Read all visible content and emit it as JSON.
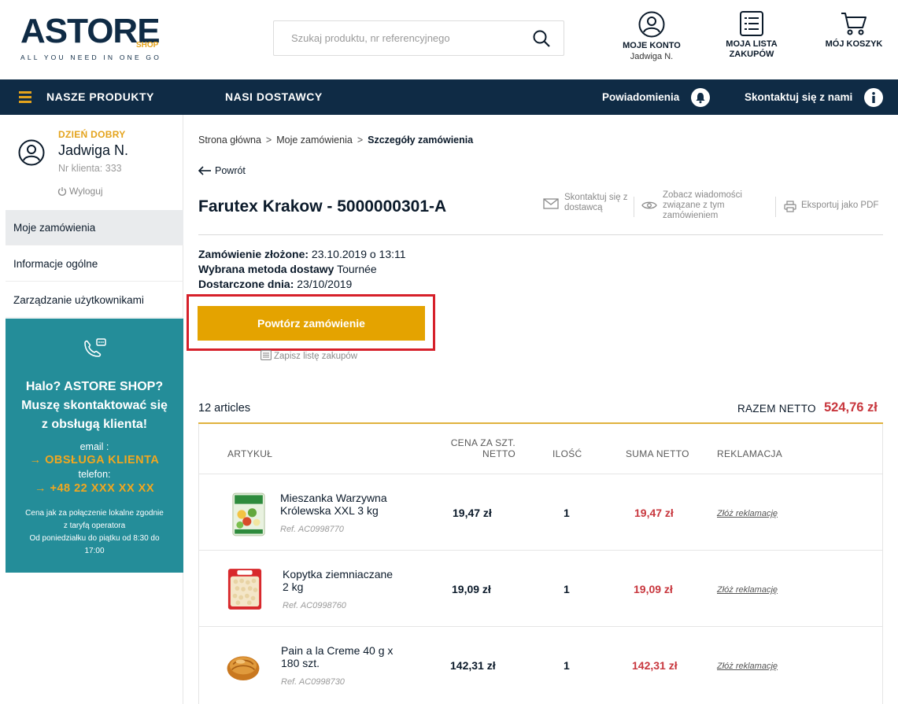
{
  "brand": {
    "name": "ASTORE",
    "sub": "SHOP",
    "tagline": "ALL YOU NEED IN ONE GO"
  },
  "search": {
    "placeholder": "Szukaj produktu, nr referencyjnego",
    "value": ""
  },
  "header": {
    "account_label": "MOJE KONTO",
    "account_user": "Jadwiga N.",
    "list_label_1": "MOJA LISTA",
    "list_label_2": "ZAKUPÓW",
    "cart_label": "MÓJ KOSZYK"
  },
  "nav": {
    "products": "NASZE PRODUKTY",
    "suppliers": "NASI DOSTAWCY",
    "notifications": "Powiadomienia",
    "contact": "Skontaktuj się z nami"
  },
  "sidebar": {
    "greeting": "DZIEŃ DOBRY",
    "user_name": "Jadwiga N.",
    "client_no": "Nr klienta: 333",
    "logout": "Wyloguj",
    "items": [
      {
        "label": "Moje zamówienia",
        "active": true
      },
      {
        "label": "Informacje ogólne",
        "active": false
      },
      {
        "label": "Zarządzanie użytkownikami",
        "active": false
      }
    ],
    "help": {
      "title_1": "Halo? ASTORE SHOP?",
      "title_2": "Muszę skontaktować się",
      "title_3": "z obsługą klienta!",
      "email_label": "email :",
      "email_value": "→ OBSŁUGA KLIENTA",
      "phone_label": "telefon:",
      "phone_value": "→ +48 22 XXX XX XX",
      "note_1": "Cena jak za połączenie lokalne zgodnie",
      "note_2": "z taryfą operatora",
      "note_3": "Od poniedziałku do piątku od 8:30 do",
      "note_4": "17:00"
    }
  },
  "breadcrumb": {
    "home": "Strona główna",
    "orders": "Moje zamówienia",
    "current": "Szczegóły zamówienia",
    "sep": ">"
  },
  "back_label": "Powrót",
  "order": {
    "title": "Farutex Krakow - 5000000301-A",
    "actions": {
      "contact_1": "Skontaktuj się z",
      "contact_2": "dostawcą",
      "messages_1": "Zobacz wiadomości",
      "messages_2": "związane z tym",
      "messages_3": "zamówieniem",
      "export": "Eksportuj jako PDF"
    },
    "placed_label": "Zamówienie złożone:",
    "placed_value": "23.10.2019 o 13:11",
    "method_label": "Wybrana metoda dostawy",
    "method_value": "Tournée",
    "delivered_label": "Dostarczone dnia:",
    "delivered_value": "23/10/2019",
    "repeat_button": "Powtórz zamówienie",
    "save_list": "Zapisz listę zakupów",
    "articles_count": "12 articles",
    "total_label": "RAZEM NETTO",
    "total_value": "524,76 zł"
  },
  "table": {
    "headers": {
      "article": "ARTYKUŁ",
      "unit_price_1": "CENA ZA SZT.",
      "unit_price_2": "NETTO",
      "qty": "ILOŚĆ",
      "sum": "SUMA NETTO",
      "claim": "REKLAMACJA"
    },
    "rows": [
      {
        "name_1": "Mieszanka Warzywna",
        "name_2": "Królewska XXL 3 kg",
        "ref": "Ref. AC0998770",
        "price": "19,47 zł",
        "qty": "1",
        "sum": "19,47 zł",
        "claim": "Złóż reklamację"
      },
      {
        "name_1": "Kopytka ziemniaczane",
        "name_2": "2 kg",
        "ref": "Ref. AC0998760",
        "price": "19,09 zł",
        "qty": "1",
        "sum": "19,09 zł",
        "claim": "Złóż reklamację"
      },
      {
        "name_1": "Pain a la Creme 40 g x",
        "name_2": "180 szt.",
        "ref": "Ref. AC0998730",
        "price": "142,31 zł",
        "qty": "1",
        "sum": "142,31 zł",
        "claim": "Złóż reklamację"
      }
    ]
  },
  "colors": {
    "navy": "#0f2b45",
    "gold": "#e4a300",
    "teal": "#248d99",
    "red": "#c8373e",
    "highlight": "#d6202a"
  }
}
